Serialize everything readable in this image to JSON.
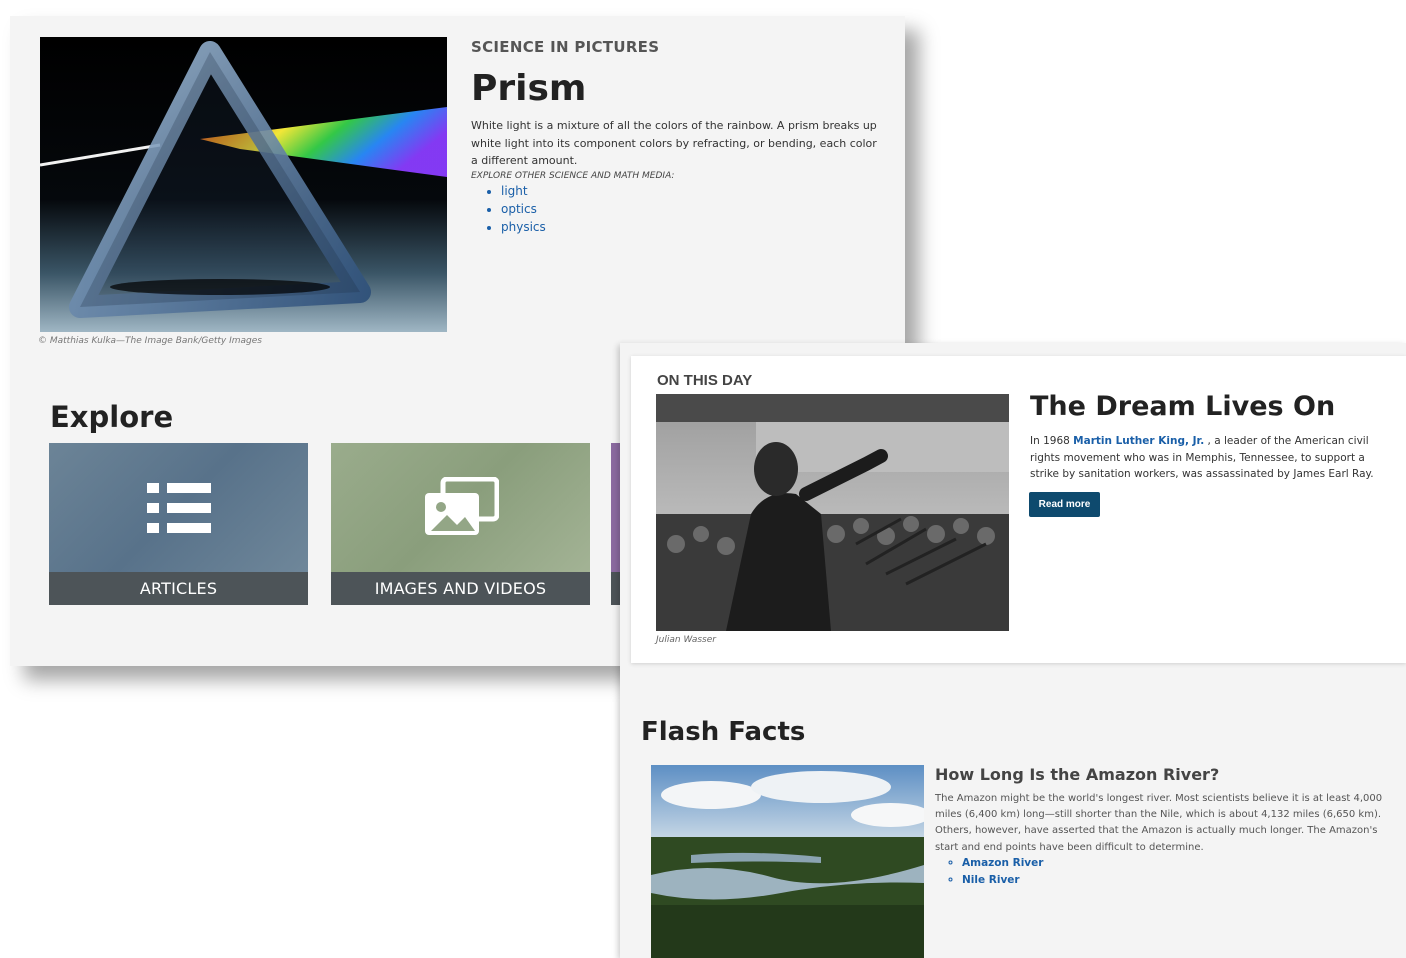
{
  "science_in_pictures": {
    "label": "SCIENCE IN PICTURES",
    "title": "Prism",
    "description": "White light is a mixture of all the colors of the rainbow. A prism breaks up white light into its component colors by refracting, or bending, each color a different amount.",
    "explore_label": "EXPLORE OTHER SCIENCE AND MATH MEDIA:",
    "links": [
      "light",
      "optics",
      "physics"
    ],
    "image_credit": "© Matthias Kulka—The Image Bank/Getty Images"
  },
  "explore": {
    "title": "Explore",
    "tiles": [
      {
        "label": "ARTICLES",
        "icon": "list-icon"
      },
      {
        "label": "IMAGES AND VIDEOS",
        "icon": "gallery-icon"
      }
    ]
  },
  "on_this_day": {
    "label": "ON THIS DAY",
    "title": "The Dream Lives On",
    "desc_before": "In 1968",
    "person_link": "Martin Luther King, Jr.",
    "desc_after": ", a leader of the American civil rights movement who was in Memphis, Tennessee, to support a strike by sanitation workers, was assassinated by James Earl Ray.",
    "button": "Read more",
    "image_credit": "Julian Wasser"
  },
  "flash_facts": {
    "title": "Flash Facts",
    "question": "How Long Is the Amazon River?",
    "answer": "The Amazon might be the world's longest river. Most scientists believe it is at least 4,000 miles (6,400 km) long—still shorter than the Nile, which is about 4,132 miles (6,650 km). Others, however, have asserted that the Amazon is actually much longer. The Amazon's start and end points have been difficult to determine.",
    "links": [
      "Amazon River",
      "Nile River"
    ]
  },
  "colors": {
    "link": "#1a5fa8",
    "button": "#0e4a6e",
    "tile_bar": "#4d5458"
  }
}
